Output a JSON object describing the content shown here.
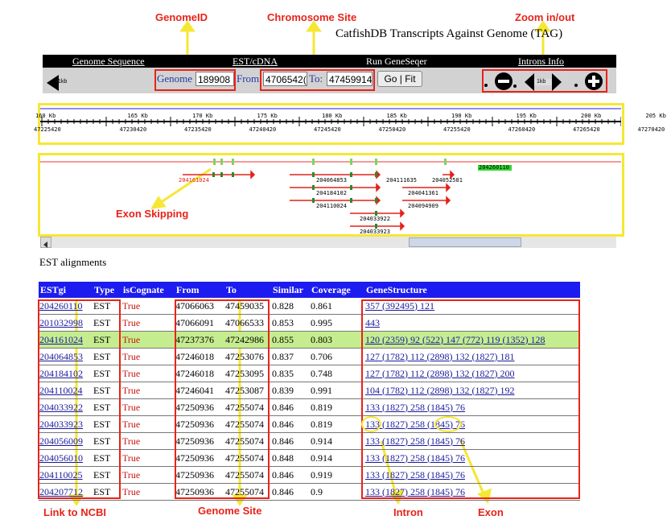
{
  "annotations": {
    "genome_id": "GenomeID",
    "chromosome_site": "Chromosome Site",
    "zoom": "Zoom in/out",
    "exon_skipping": "Exon Skipping",
    "link_ncbi": "Link to NCBI",
    "genome_site": "Genome Site",
    "intron": "Intron",
    "exon": "Exon"
  },
  "page_title": "CatfishDB Transcripts Against Genome (TAG)",
  "nav": {
    "genome_sequence": "Genome Sequence",
    "est_cdna": "EST/cDNA",
    "run_geneseqer": "Run GeneSeqer",
    "introns_info": "Introns Info"
  },
  "toolbar": {
    "back_label": "1kb",
    "genome_label": "Genome",
    "genome_value": "189908",
    "from_label": "From",
    "from_value": "4706542(",
    "to_label": "To:",
    "to_value": "47459914",
    "go_fit": "Go | Fit",
    "zoom_label": "1kb"
  },
  "ruler": {
    "kb_labels": [
      "160 Kb",
      "165 Kb",
      "170 Kb",
      "175 Kb",
      "180 Kb",
      "185 Kb",
      "190 Kb",
      "195 Kb",
      "200 Kb",
      "205 Kb"
    ],
    "pos_labels": [
      "47225420",
      "47230420",
      "47235420",
      "47240420",
      "47245420",
      "47250420",
      "47255420",
      "47260420",
      "47265420",
      "47270420"
    ]
  },
  "tracks": {
    "labels": [
      "204161024",
      "204064853",
      "204111635",
      "204052581",
      "204184102",
      "204041361",
      "204110024",
      "204094909",
      "204033922",
      "204033923",
      "204260110"
    ]
  },
  "section_title": "EST alignments",
  "table": {
    "headers": [
      "ESTgi",
      "Type",
      "isCognate",
      "From",
      "To",
      "Similar",
      "Coverage",
      "GeneStructure"
    ],
    "rows": [
      {
        "gi": "204260110",
        "type": "EST",
        "cog": "True",
        "from": "47066063",
        "to": "47459035",
        "sim": "0.828",
        "cov": "0.861",
        "gs": "357 (392495) 121",
        "hl": false
      },
      {
        "gi": "201032998",
        "type": "EST",
        "cog": "True",
        "from": "47066091",
        "to": "47066533",
        "sim": "0.853",
        "cov": "0.995",
        "gs": "443",
        "hl": false
      },
      {
        "gi": "204161024",
        "type": "EST",
        "cog": "True",
        "from": "47237376",
        "to": "47242986",
        "sim": "0.855",
        "cov": "0.803",
        "gs": "120 (2359) 92 (522) 147 (772) 119 (1352) 128",
        "hl": true
      },
      {
        "gi": "204064853",
        "type": "EST",
        "cog": "True",
        "from": "47246018",
        "to": "47253076",
        "sim": "0.837",
        "cov": "0.706",
        "gs": "127 (1782) 112 (2898) 132 (1827) 181",
        "hl": false
      },
      {
        "gi": "204184102",
        "type": "EST",
        "cog": "True",
        "from": "47246018",
        "to": "47253095",
        "sim": "0.835",
        "cov": "0.748",
        "gs": "127 (1782) 112 (2898) 132 (1827) 200",
        "hl": false
      },
      {
        "gi": "204110024",
        "type": "EST",
        "cog": "True",
        "from": "47246041",
        "to": "47253087",
        "sim": "0.839",
        "cov": "0.991",
        "gs": "104 (1782) 112 (2898) 132 (1827) 192",
        "hl": false
      },
      {
        "gi": "204033922",
        "type": "EST",
        "cog": "True",
        "from": "47250936",
        "to": "47255074",
        "sim": "0.846",
        "cov": "0.819",
        "gs": "133 (1827) 258 (1845) 76",
        "hl": false
      },
      {
        "gi": "204033923",
        "type": "EST",
        "cog": "True",
        "from": "47250936",
        "to": "47255074",
        "sim": "0.846",
        "cov": "0.819",
        "gs": "133 (1827) 258 (1845) 76",
        "hl": false
      },
      {
        "gi": "204056009",
        "type": "EST",
        "cog": "True",
        "from": "47250936",
        "to": "47255074",
        "sim": "0.846",
        "cov": "0.914",
        "gs": "133 (1827) 258 (1845) 76",
        "hl": false
      },
      {
        "gi": "204056010",
        "type": "EST",
        "cog": "True",
        "from": "47250936",
        "to": "47255074",
        "sim": "0.848",
        "cov": "0.914",
        "gs": "133 (1827) 258 (1845) 76",
        "hl": false
      },
      {
        "gi": "204110025",
        "type": "EST",
        "cog": "True",
        "from": "47250936",
        "to": "47255074",
        "sim": "0.846",
        "cov": "0.919",
        "gs": "133 (1827) 258 (1845) 76",
        "hl": false
      },
      {
        "gi": "204207712",
        "type": "EST",
        "cog": "True",
        "from": "47250936",
        "to": "47255074",
        "sim": "0.846",
        "cov": "0.9",
        "gs": "133 (1827) 258 (1845) 76",
        "hl": false
      }
    ]
  }
}
